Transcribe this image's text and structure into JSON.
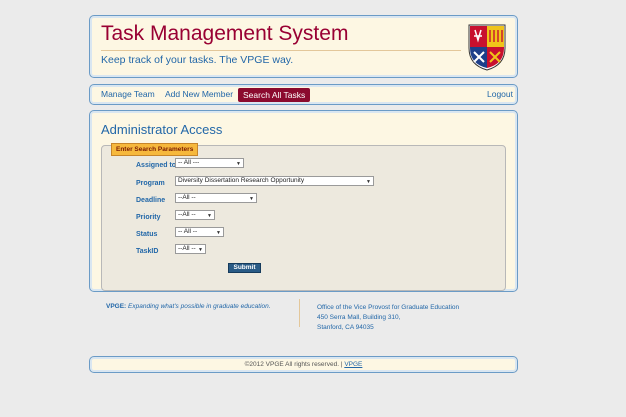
{
  "header": {
    "title": "Task Management System",
    "tagline": "Keep track of your tasks. The VPGE way."
  },
  "nav": {
    "manage_team": "Manage Team",
    "add_member": "Add New Member",
    "search_all": "Search All Tasks",
    "logout": "Logout"
  },
  "main": {
    "title": "Administrator Access",
    "legend": "Enter Search Parameters",
    "fields": {
      "assigned_to": {
        "label": "Assigned to",
        "value": "-- All ---"
      },
      "program": {
        "label": "Program",
        "value": "Diversity Dissertation Research Opportunity"
      },
      "deadline": {
        "label": "Deadline",
        "value": "--All --"
      },
      "priority": {
        "label": "Priority",
        "value": "--All --"
      },
      "status": {
        "label": "Status",
        "value": "-- All --"
      },
      "taskid": {
        "label": "TaskID",
        "value": "--All --"
      }
    },
    "submit": "Submit"
  },
  "vpge": {
    "name": "VPGE:",
    "slogan": "Expanding what's possible in graduate education.",
    "office": "Office of the Vice Provost for Graduate Education",
    "address1": "450 Serra Mall, Building 310,",
    "address2": "Stanford, CA 94035"
  },
  "footer": {
    "copyright": "©2012 VPGE All rights reserved. |",
    "link": "VPGE"
  },
  "colors": {
    "title": "#990033",
    "link": "#2267a8",
    "active_nav": "#8b0a2e",
    "panel_bg": "#fdf7e3",
    "border": "#6b9bc6"
  }
}
